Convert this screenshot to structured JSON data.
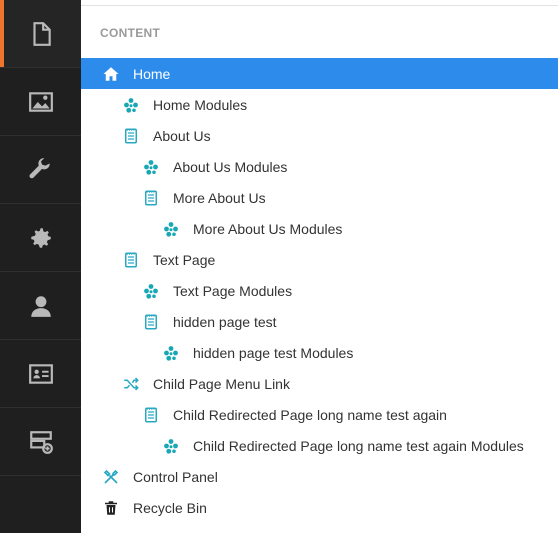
{
  "colors": {
    "rail_bg": "#1f1f1f",
    "rail_accent": "#f0752c",
    "selection": "#2d8ceb",
    "module_icon": "#18a7b5",
    "page_icon": "#28a9c3"
  },
  "rail": {
    "items": [
      {
        "icon": "document-icon",
        "active": true
      },
      {
        "icon": "image-icon",
        "active": false
      },
      {
        "icon": "wrench-icon",
        "active": false
      },
      {
        "icon": "gear-icon",
        "active": false
      },
      {
        "icon": "user-icon",
        "active": false
      },
      {
        "icon": "contact-card-icon",
        "active": false
      },
      {
        "icon": "add-layout-icon",
        "active": false
      }
    ]
  },
  "content": {
    "section_title": "CONTENT",
    "tree": [
      {
        "label": "Home",
        "icon": "home-icon",
        "depth": 0,
        "selected": true
      },
      {
        "label": "Home Modules",
        "icon": "modules-icon",
        "depth": 1
      },
      {
        "label": "About Us",
        "icon": "page-icon",
        "depth": 1
      },
      {
        "label": "About Us Modules",
        "icon": "modules-icon",
        "depth": 2
      },
      {
        "label": "More About Us",
        "icon": "page-icon",
        "depth": 2
      },
      {
        "label": "More About Us Modules",
        "icon": "modules-icon",
        "depth": 3
      },
      {
        "label": "Text Page",
        "icon": "page-icon",
        "depth": 1
      },
      {
        "label": "Text Page Modules",
        "icon": "modules-icon",
        "depth": 2
      },
      {
        "label": "hidden page test",
        "icon": "page-icon",
        "depth": 2
      },
      {
        "label": "hidden page test Modules",
        "icon": "modules-icon",
        "depth": 3
      },
      {
        "label": "Child Page Menu Link",
        "icon": "shuffle-icon",
        "depth": 1
      },
      {
        "label": "Child Redirected Page long name test again",
        "icon": "page-icon",
        "depth": 2
      },
      {
        "label": "Child Redirected Page long name test again Modules",
        "icon": "modules-icon",
        "depth": 3
      },
      {
        "label": "Control Panel",
        "icon": "tools-icon",
        "depth": 0
      },
      {
        "label": "Recycle Bin",
        "icon": "trash-icon",
        "depth": 0
      }
    ]
  }
}
